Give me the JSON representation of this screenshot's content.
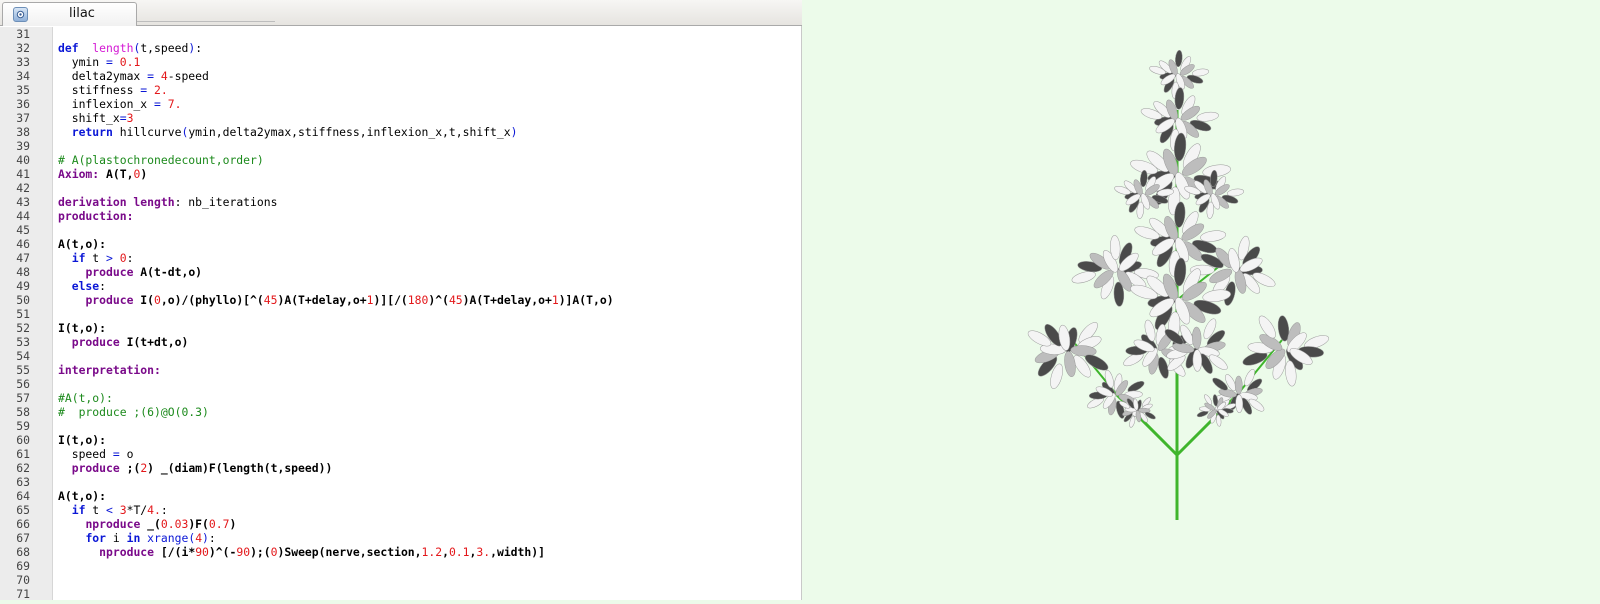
{
  "editor": {
    "tab_label": "lilac",
    "tab_icon": "python-file-icon",
    "lines": [
      {
        "n": "31",
        "segs": []
      },
      {
        "n": "32",
        "segs": [
          [
            "kw-blue",
            "def"
          ],
          [
            "",
            "  "
          ],
          [
            "fn",
            "length"
          ],
          [
            "op",
            "("
          ],
          [
            "",
            "t,speed"
          ],
          [
            "op",
            ")"
          ],
          [
            "",
            ":"
          ]
        ]
      },
      {
        "n": "33",
        "segs": [
          [
            "",
            "  ymin "
          ],
          [
            "op",
            "="
          ],
          [
            "num",
            " 0.1"
          ]
        ]
      },
      {
        "n": "34",
        "segs": [
          [
            "",
            "  delta2ymax "
          ],
          [
            "op",
            "="
          ],
          [
            "num",
            " 4"
          ],
          [
            "",
            "-speed"
          ]
        ]
      },
      {
        "n": "35",
        "segs": [
          [
            "",
            "  stiffness "
          ],
          [
            "op",
            "="
          ],
          [
            "num",
            " 2."
          ]
        ]
      },
      {
        "n": "36",
        "segs": [
          [
            "",
            "  inflexion_x "
          ],
          [
            "op",
            "="
          ],
          [
            "num",
            " 7."
          ]
        ]
      },
      {
        "n": "37",
        "segs": [
          [
            "",
            "  shift_x"
          ],
          [
            "op",
            "="
          ],
          [
            "num",
            "3"
          ]
        ]
      },
      {
        "n": "38",
        "segs": [
          [
            "",
            "  "
          ],
          [
            "kw-blue",
            "return"
          ],
          [
            "",
            " hillcurve"
          ],
          [
            "op",
            "("
          ],
          [
            "",
            "ymin,delta2ymax,stiffness,inflexion_x,t,shift_x"
          ],
          [
            "op",
            ")"
          ]
        ]
      },
      {
        "n": "39",
        "segs": []
      },
      {
        "n": "40",
        "segs": [
          [
            "cm",
            "# A(plastochronedecount,order)"
          ]
        ]
      },
      {
        "n": "41",
        "segs": [
          [
            "kw-purple",
            "Axiom:"
          ],
          [
            "bold",
            " A(T,"
          ],
          [
            "num",
            "0"
          ],
          [
            "bold",
            ")"
          ]
        ]
      },
      {
        "n": "42",
        "segs": []
      },
      {
        "n": "43",
        "segs": [
          [
            "kw-purple",
            "derivation length"
          ],
          [
            "",
            ": nb_iterations"
          ]
        ]
      },
      {
        "n": "44",
        "segs": [
          [
            "kw-purple",
            "production:"
          ]
        ]
      },
      {
        "n": "45",
        "segs": []
      },
      {
        "n": "46",
        "segs": [
          [
            "bold",
            "A(t,o):"
          ]
        ]
      },
      {
        "n": "47",
        "segs": [
          [
            "",
            "  "
          ],
          [
            "kw-blue",
            "if"
          ],
          [
            "",
            " t "
          ],
          [
            "op",
            ">"
          ],
          [
            "num",
            " 0"
          ],
          [
            "",
            ":"
          ]
        ]
      },
      {
        "n": "48",
        "segs": [
          [
            "",
            "    "
          ],
          [
            "kw-purple",
            "produce"
          ],
          [
            "bold",
            " A(t-dt,o)"
          ]
        ]
      },
      {
        "n": "49",
        "segs": [
          [
            "",
            "  "
          ],
          [
            "kw-blue",
            "else"
          ],
          [
            "",
            ":"
          ]
        ]
      },
      {
        "n": "50",
        "segs": [
          [
            "",
            "    "
          ],
          [
            "kw-purple",
            "produce"
          ],
          [
            "bold",
            " I("
          ],
          [
            "num",
            "0"
          ],
          [
            "bold",
            ",o)/(phyllo)[^("
          ],
          [
            "num",
            "45"
          ],
          [
            "bold",
            ")A(T+delay,o+"
          ],
          [
            "num",
            "1"
          ],
          [
            "bold",
            ")][/("
          ],
          [
            "num",
            "180"
          ],
          [
            "bold",
            ")^("
          ],
          [
            "num",
            "45"
          ],
          [
            "bold",
            ")A(T+delay,o+"
          ],
          [
            "num",
            "1"
          ],
          [
            "bold",
            ")]A(T,o)"
          ]
        ]
      },
      {
        "n": "51",
        "segs": []
      },
      {
        "n": "52",
        "segs": [
          [
            "bold",
            "I(t,o):"
          ]
        ]
      },
      {
        "n": "53",
        "segs": [
          [
            "",
            "  "
          ],
          [
            "kw-purple",
            "produce"
          ],
          [
            "bold",
            " I(t+dt,o)"
          ]
        ]
      },
      {
        "n": "54",
        "segs": []
      },
      {
        "n": "55",
        "segs": [
          [
            "kw-purple",
            "interpretation:"
          ]
        ]
      },
      {
        "n": "56",
        "segs": []
      },
      {
        "n": "57",
        "segs": [
          [
            "cm",
            "#A(t,o):"
          ]
        ]
      },
      {
        "n": "58",
        "segs": [
          [
            "cm",
            "#  produce ;(6)@O(0.3)"
          ]
        ]
      },
      {
        "n": "59",
        "segs": []
      },
      {
        "n": "60",
        "segs": [
          [
            "bold",
            "I(t,o):"
          ]
        ]
      },
      {
        "n": "61",
        "segs": [
          [
            "",
            "  speed "
          ],
          [
            "op",
            "="
          ],
          [
            "",
            " o"
          ]
        ]
      },
      {
        "n": "62",
        "segs": [
          [
            "",
            "  "
          ],
          [
            "kw-purple",
            "produce"
          ],
          [
            "bold",
            " ;("
          ],
          [
            "num",
            "2"
          ],
          [
            "bold",
            ") _(diam)F(length(t,speed))"
          ]
        ]
      },
      {
        "n": "63",
        "segs": []
      },
      {
        "n": "64",
        "segs": [
          [
            "bold",
            "A(t,o):"
          ]
        ]
      },
      {
        "n": "65",
        "segs": [
          [
            "",
            "  "
          ],
          [
            "kw-blue",
            "if"
          ],
          [
            "",
            " t "
          ],
          [
            "op",
            "<"
          ],
          [
            "num",
            " 3"
          ],
          [
            "",
            "*T/"
          ],
          [
            "num",
            "4."
          ],
          [
            "",
            ":"
          ]
        ]
      },
      {
        "n": "66",
        "segs": [
          [
            "",
            "    "
          ],
          [
            "kw-purple",
            "nproduce"
          ],
          [
            "bold",
            " _("
          ],
          [
            "num",
            "0.03"
          ],
          [
            "bold",
            ")F("
          ],
          [
            "num",
            "0.7"
          ],
          [
            "bold",
            ")"
          ]
        ]
      },
      {
        "n": "67",
        "segs": [
          [
            "",
            "    "
          ],
          [
            "kw-blue",
            "for"
          ],
          [
            "",
            " i "
          ],
          [
            "kw-blue",
            "in"
          ],
          [
            "",
            " "
          ],
          [
            "op",
            "xrange("
          ],
          [
            "num",
            "4"
          ],
          [
            "op",
            ")"
          ],
          [
            "",
            ":"
          ]
        ]
      },
      {
        "n": "68",
        "segs": [
          [
            "",
            "      "
          ],
          [
            "kw-purple",
            "nproduce"
          ],
          [
            "bold",
            " [/(i*"
          ],
          [
            "num",
            "90"
          ],
          [
            "bold",
            ")^(-"
          ],
          [
            "num",
            "90"
          ],
          [
            "bold",
            ");("
          ],
          [
            "num",
            "0"
          ],
          [
            "bold",
            ")Sweep(nerve,section,"
          ],
          [
            "num",
            "1.2"
          ],
          [
            "bold",
            ","
          ],
          [
            "num",
            "0.1"
          ],
          [
            "bold",
            ","
          ],
          [
            "num",
            "3."
          ],
          [
            "bold",
            ",width)]"
          ]
        ]
      },
      {
        "n": "69",
        "segs": []
      },
      {
        "n": "70",
        "segs": []
      },
      {
        "n": "71",
        "segs": []
      }
    ]
  },
  "viewer": {
    "background": "#ecfbea",
    "stem_color": "#3fb52c",
    "petal_light": "#f4f4f4",
    "petal_mid": "#bdbdbd",
    "petal_dark": "#4a4a4a"
  }
}
